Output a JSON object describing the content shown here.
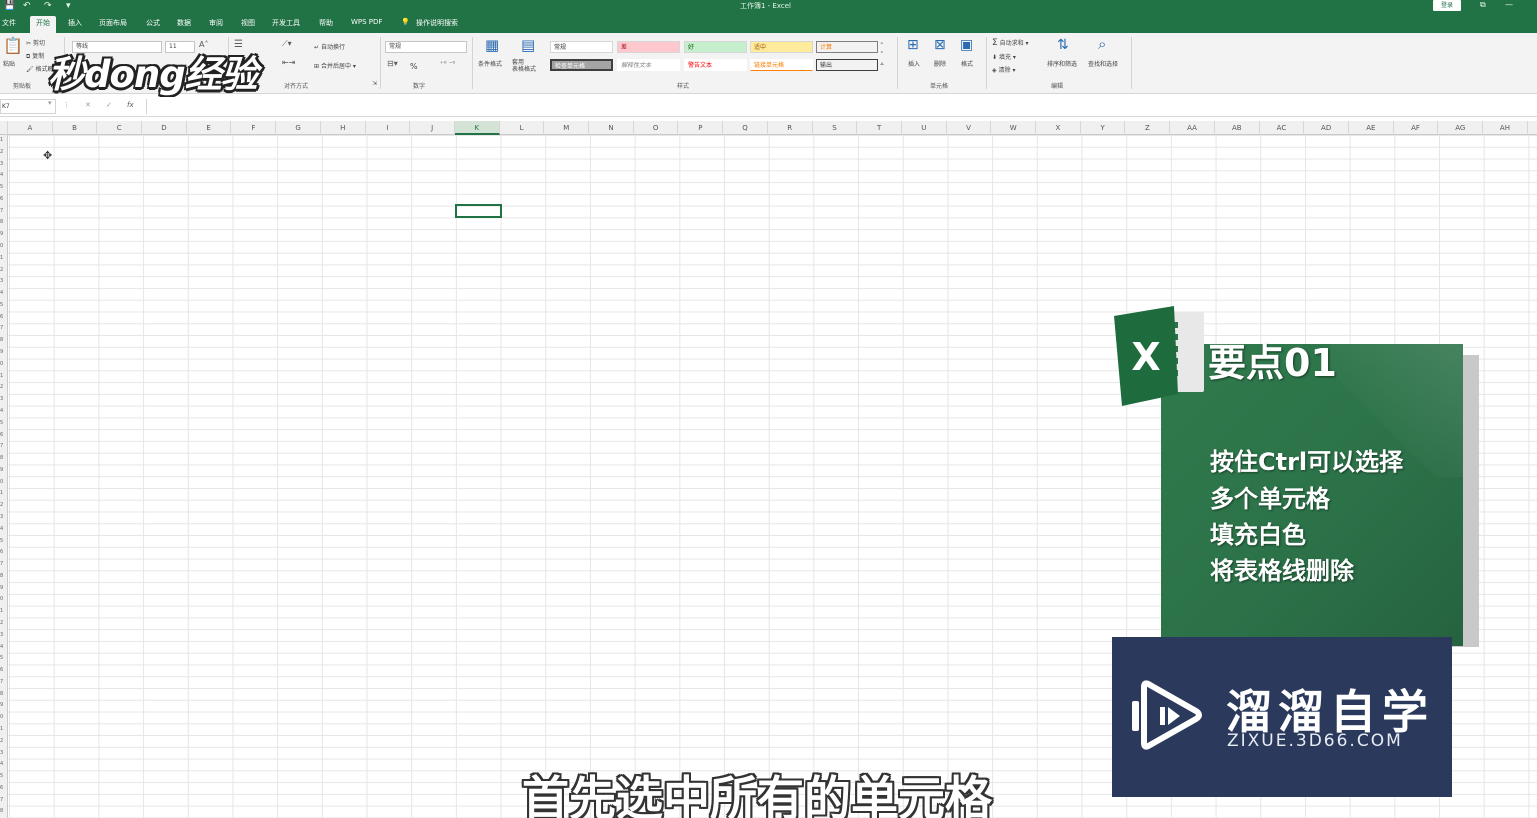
{
  "titlebar": {
    "quick_access": [
      "💾",
      "↶",
      "↷",
      "▾"
    ],
    "window_title": "工作簿1 - Excel",
    "login_label": "登录",
    "window_buttons": [
      "—",
      "⧉",
      "✕"
    ]
  },
  "menu": {
    "tabs": [
      "文件",
      "开始",
      "插入",
      "页面布局",
      "公式",
      "数据",
      "审阅",
      "视图",
      "开发工具",
      "帮助",
      "WPS PDF"
    ],
    "search_label": "操作说明搜索"
  },
  "ribbon": {
    "clipboard": {
      "paste": "粘贴",
      "cut": "剪切",
      "copy": "复制",
      "format_painter": "格式刷",
      "group": "剪贴板"
    },
    "font": {
      "name": "等线",
      "size": "11"
    },
    "alignment": {
      "wrap": "自动换行",
      "merge": "合并后居中",
      "group": "对齐方式"
    },
    "number": {
      "format": "常规",
      "percent": "%",
      "group": "数字"
    },
    "styles": {
      "conditional": "条件格式",
      "table": "套用\n表格格式",
      "cells": [
        "常规",
        "差",
        "好",
        "适中",
        "计算",
        "检查单元格",
        "解释性文本",
        "警告文本",
        "链接单元格",
        "输出"
      ],
      "group": "样式"
    },
    "cells_group": {
      "insert": "插入",
      "delete": "删除",
      "format": "格式",
      "group": "单元格"
    },
    "editing": {
      "autosum": "自动求和",
      "fill": "填充",
      "clear": "清除",
      "sort": "排序和筛选",
      "find": "查找和选择",
      "group": "编辑"
    }
  },
  "logo": "秒dong经验",
  "formula_bar": {
    "name_box": "K7",
    "cancel": "✕",
    "confirm": "✓",
    "fx": "fx"
  },
  "columns": [
    "A",
    "B",
    "C",
    "D",
    "E",
    "F",
    "G",
    "H",
    "I",
    "J",
    "K",
    "L",
    "M",
    "N",
    "O",
    "P",
    "Q",
    "R",
    "S",
    "T",
    "U",
    "V",
    "W",
    "X",
    "Y",
    "Z",
    "AA",
    "AB",
    "AC",
    "AD",
    "AE",
    "AF",
    "AG",
    "AH"
  ],
  "selected_column": "K",
  "rows": [
    "1",
    "2",
    "3",
    "4",
    "5",
    "6",
    "7",
    "8",
    "9",
    "0",
    "1",
    "2",
    "3",
    "4",
    "5",
    "6",
    "7",
    "8",
    "9",
    "0",
    "1",
    "2",
    "3",
    "4",
    "5",
    "6",
    "7",
    "8",
    "9",
    "0",
    "1",
    "2",
    "3",
    "4",
    "5",
    "6",
    "7",
    "8",
    "9",
    "0",
    "1",
    "2",
    "3",
    "4",
    "5",
    "6",
    "7",
    "8",
    "9",
    "0",
    "1",
    "2",
    "3",
    "4",
    "5",
    "6",
    "7",
    "8"
  ],
  "card": {
    "icon_letter": "X",
    "heading": "要点01",
    "lines": [
      "按住Ctrl可以选择",
      "多个单元格",
      "填充白色",
      "将表格线删除"
    ]
  },
  "brand": {
    "name": "溜溜自学",
    "url": "ZIXUE.3D66.COM"
  },
  "subtitle": "首先选中所有的单元格",
  "colors": {
    "excel_green": "#217346",
    "card_green": "#2c7249",
    "brand_navy": "#2b3a5c"
  }
}
